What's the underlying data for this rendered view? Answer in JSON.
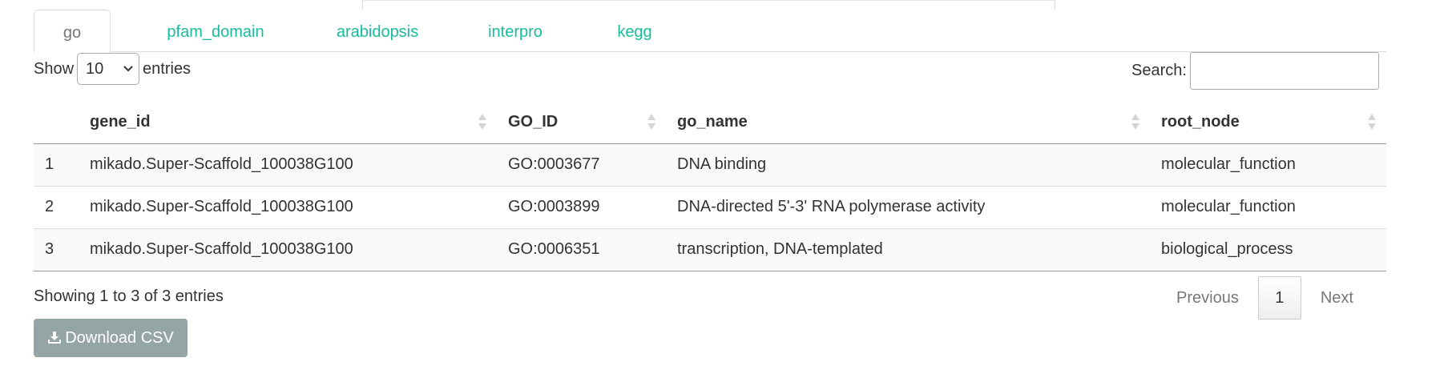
{
  "tabs": [
    {
      "label": "go",
      "active": true
    },
    {
      "label": "pfam_domain",
      "active": false
    },
    {
      "label": "arabidopsis",
      "active": false
    },
    {
      "label": "interpro",
      "active": false
    },
    {
      "label": "kegg",
      "active": false
    }
  ],
  "length": {
    "show_label": "Show",
    "value": "10",
    "entries_label": "entries"
  },
  "search": {
    "label": "Search:",
    "value": ""
  },
  "table": {
    "headers": [
      "",
      "gene_id",
      "GO_ID",
      "go_name",
      "root_node"
    ],
    "rows": [
      [
        "1",
        "mikado.Super-Scaffold_100038G100",
        "GO:0003677",
        "DNA binding",
        "molecular_function"
      ],
      [
        "2",
        "mikado.Super-Scaffold_100038G100",
        "GO:0003899",
        "DNA-directed 5'-3' RNA polymerase activity",
        "molecular_function"
      ],
      [
        "3",
        "mikado.Super-Scaffold_100038G100",
        "GO:0006351",
        "transcription, DNA-templated",
        "biological_process"
      ]
    ]
  },
  "info": "Showing 1 to 3 of 3 entries",
  "pagination": {
    "previous": "Previous",
    "current": "1",
    "next": "Next"
  },
  "download": {
    "label": "Download CSV",
    "icon": "download-icon"
  },
  "colors": {
    "accent": "#18bc9c",
    "button": "#95a5a6",
    "stripe": "#f9f9f9"
  }
}
